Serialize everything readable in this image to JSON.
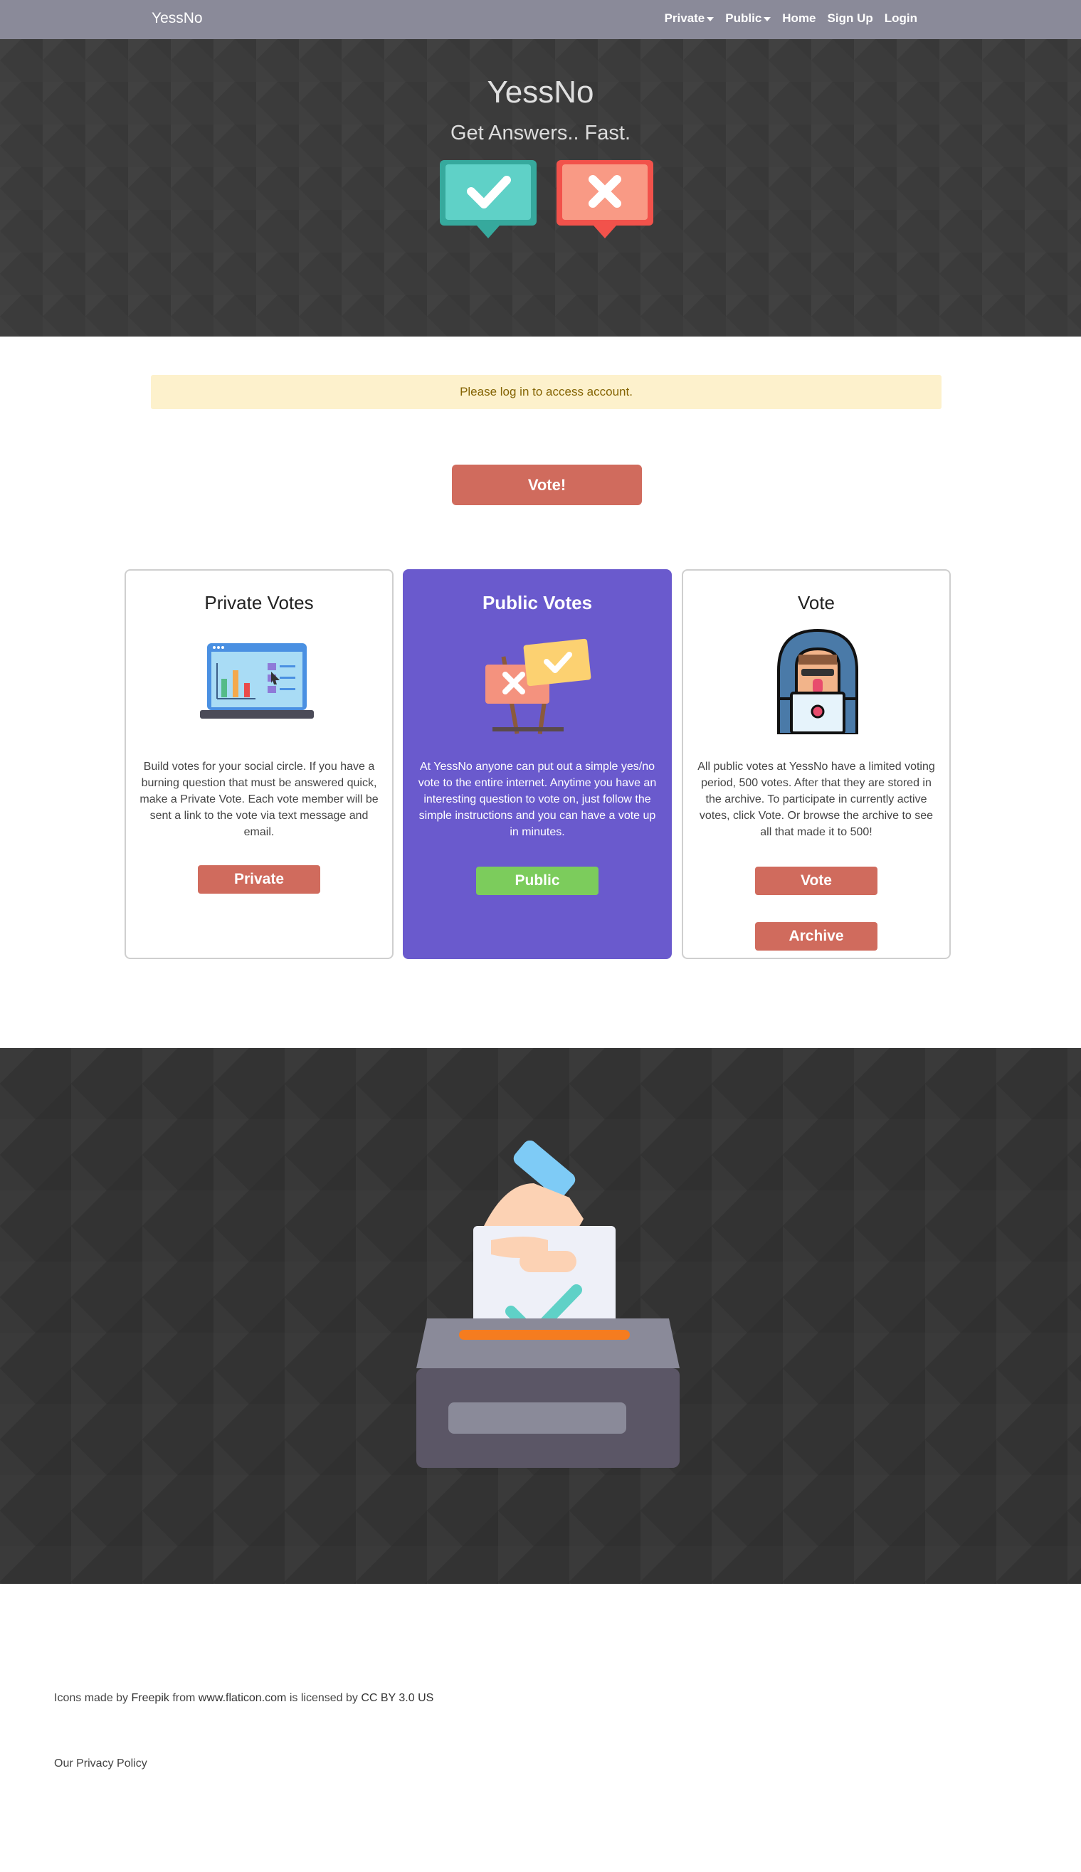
{
  "navbar": {
    "brand": "YessNo",
    "links": [
      "Private",
      "Public",
      "Home",
      "Sign Up",
      "Login"
    ]
  },
  "hero": {
    "title": "YessNo",
    "subtitle": "Get Answers.. Fast.",
    "icons": [
      "yes-check-icon",
      "no-x-icon"
    ]
  },
  "alert": {
    "text": "Please log in to access account."
  },
  "vote_button": "Vote!",
  "cards": [
    {
      "title": "Private Votes",
      "icon": "laptop-chart-icon",
      "text": "Build votes for your social circle. If you have a burning question that must be answered quick, make a Private Vote. Each vote member will be sent a link to the vote via text message and email.",
      "button": "Private"
    },
    {
      "title": "Public Votes",
      "icon": "signs-icon",
      "text": "At YessNo anyone can put out a simple yes/no vote to the entire internet. Anytime you have an interesting question to vote on, just follow the simple instructions and you can have a vote up in minutes.",
      "button": "Public"
    },
    {
      "title": "Vote",
      "icon": "hooded-hacker-icon",
      "text": "All public votes at YessNo have a limited voting period, 500 votes. After that they are stored in the archive. To participate in currently active votes, click Vote. Or browse the archive to see all that made it to 500!",
      "button": "Vote",
      "button2": "Archive"
    }
  ],
  "ballot_icon": "ballot-box-icon",
  "footer": {
    "credit_prefix": "Icons made by",
    "credit_author": "Freepik",
    "credit_from": "from",
    "credit_site": "www.flaticon.com",
    "credit_license_prefix": "is licensed by",
    "credit_license": "CC BY 3.0 US",
    "privacy": "Our Privacy Policy"
  },
  "colors": {
    "navbar": "#8a8a99",
    "hero_bg": "#3b3b3b",
    "button_red": "#d06b5d",
    "card_purple": "#6a5acd",
    "button_green": "#7ccc5c",
    "alert_bg": "#fdf1cc"
  }
}
